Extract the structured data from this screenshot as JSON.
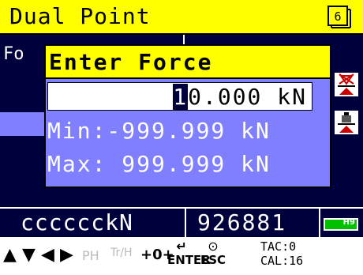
{
  "header": {
    "title": "Dual Point",
    "page_number": "6"
  },
  "background": {
    "label": "Fo"
  },
  "dialog": {
    "title": "Enter Force",
    "value": {
      "cursor_char": "1",
      "rest": "0.000",
      "unit": "kN"
    },
    "min_line": "Min:-999.999 kN",
    "max_line": "Max: 999.999 kN"
  },
  "status": {
    "left_text": "cccccckN",
    "right_text": "926881",
    "battery_label": "H9"
  },
  "keys": {
    "up": "▲",
    "down": "▼",
    "left": "◀",
    "right": "▶",
    "ph": "PH",
    "tr_h": "Tr/H",
    "zero": "+0+",
    "enter": "ENTER",
    "esc": "ESC"
  },
  "info": {
    "tac": "TAC:0",
    "cal": "CAL:16"
  },
  "colors": {
    "yellow": "#ffff00",
    "navy": "#00003c",
    "dialog": "#7f7fff",
    "battery": "#00c000"
  }
}
